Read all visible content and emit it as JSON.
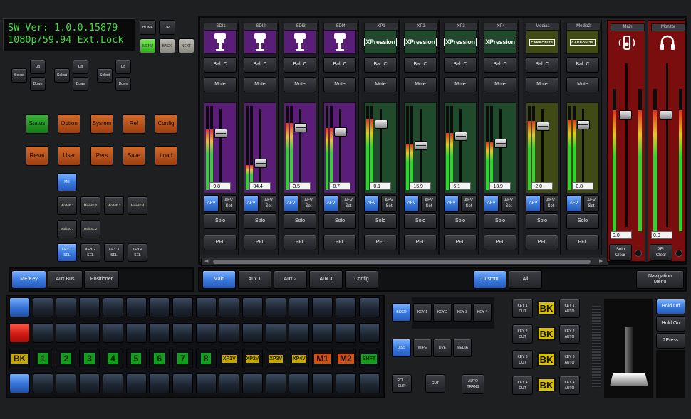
{
  "display": {
    "line1": "SW Ver: 1.0.0.15879",
    "line2": "1080p/59.94 Ext.Lock"
  },
  "nav": {
    "home": "HOME",
    "up": "UP",
    "menu": "MENU",
    "back": "BACK",
    "next": "NEXT"
  },
  "selectors": [
    {
      "select": "Select",
      "up": "Up",
      "down": "Down"
    },
    {
      "select": "Select",
      "up": "Up",
      "down": "Down"
    },
    {
      "select": "Select",
      "up": "Up",
      "down": "Down"
    }
  ],
  "menu_row1": [
    "Status",
    "Option",
    "System",
    "Ref",
    "Config"
  ],
  "menu_row2": [
    "Reset",
    "User",
    "Pers",
    "Save",
    "Load"
  ],
  "me": {
    "label": "ME"
  },
  "minime_row": [
    "MiniME 1",
    "MiniME 2",
    "MiniME 3",
    "MiniME 4"
  ],
  "multisc_row": [
    "MultiSc 1",
    "MultiSc 2"
  ],
  "key_sel_row": [
    "KEY 1\nSEL",
    "KEY 2\nSEL",
    "KEY 3\nSEL",
    "KEY 4\nSEL"
  ],
  "left_tabs": [
    "ME/Key",
    "Aux Bus",
    "Positioner"
  ],
  "audio": {
    "strips": [
      {
        "name": "SDI1",
        "icon": "mic-icon",
        "value": "-9.8",
        "color": "#5a1e78",
        "level": 0.72
      },
      {
        "name": "SDI2",
        "icon": "mic-icon",
        "value": "-34.4",
        "color": "#5a1e78",
        "level": 0.3
      },
      {
        "name": "SDI3",
        "icon": "mic-icon",
        "value": "-3.5",
        "color": "#5a1e78",
        "level": 0.8
      },
      {
        "name": "SDI4",
        "icon": "mic-icon",
        "value": "-8.7",
        "color": "#5a1e78",
        "level": 0.74
      },
      {
        "name": "XP1",
        "icon": "XPression",
        "value": "-0.1",
        "color": "#1f4a2c",
        "level": 0.85
      },
      {
        "name": "XP2",
        "icon": "XPression",
        "value": "-15.9",
        "color": "#1f4a2c",
        "level": 0.55
      },
      {
        "name": "XP3",
        "icon": "XPression",
        "value": "-6.1",
        "color": "#1f4a2c",
        "level": 0.68
      },
      {
        "name": "XP4",
        "icon": "XPression",
        "value": "-13.9",
        "color": "#1f4a2c",
        "level": 0.58
      },
      {
        "name": "Media1",
        "icon": "CARBONITE",
        "value": "-2.0",
        "color": "#3f4a14",
        "level": 0.82
      },
      {
        "name": "Media2",
        "icon": "CARBONITE",
        "value": "-0.8",
        "color": "#3f4a14",
        "level": 0.84
      }
    ],
    "bal": "Bal: C",
    "mute": "Mute",
    "afv": "AFV",
    "afv_set": "AFV\nSet",
    "solo": "Solo",
    "pfl": "PFL",
    "main": {
      "name": "Main",
      "value": "0.0",
      "clear": "Solo\nClear",
      "level": 0.85
    },
    "monitor": {
      "name": "Monitor",
      "value": "0.0",
      "clear": "PFL\nClear",
      "level": 0.85
    },
    "tabs": [
      "Main",
      "Aux 1",
      "Aux 2",
      "Aux 3",
      "Config"
    ],
    "custom": "Custom",
    "all": "All",
    "navigation_menu": "Navigation\nMenu"
  },
  "preview_row": [
    "BK",
    "1",
    "2",
    "3",
    "4",
    "5",
    "6",
    "7",
    "8",
    "XP1V",
    "XP2V",
    "XP3V",
    "XP4V",
    "M1",
    "M2",
    "SHFT"
  ],
  "transition": {
    "bkgd": "BKGD",
    "keys": [
      "KEY 1",
      "KEY 2",
      "KEY 3",
      "KEY 4"
    ],
    "diss": "DISS",
    "wipe": "WIPE",
    "dve": "DVE",
    "media": "MEDIA",
    "roll_clip": "ROLL\nCLIP",
    "cut": "CUT",
    "auto_trans": "AUTO\nTRANS"
  },
  "keyers": [
    {
      "cut": "KEY 1\nCUT",
      "bk": "BK",
      "auto": "KEY 1\nAUTO"
    },
    {
      "cut": "KEY 2\nCUT",
      "bk": "BK",
      "auto": "KEY 2\nAUTO"
    },
    {
      "cut": "KEY 3\nCUT",
      "bk": "BK",
      "auto": "KEY 3\nAUTO"
    },
    {
      "cut": "KEY 4\nCUT",
      "bk": "BK",
      "auto": "KEY 4\nAUTO"
    }
  ],
  "hold": {
    "off": "Hold Off",
    "on": "Hold On",
    "two_press": "2Press"
  },
  "tbar_position": 0.9
}
